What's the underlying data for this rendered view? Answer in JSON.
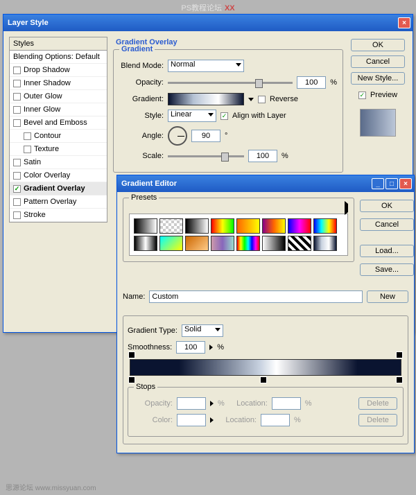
{
  "watermark": {
    "text1": "PS教程论坛",
    "text2": "XX"
  },
  "footer": "思源论坛  www.missyuan.com",
  "layerStyle": {
    "title": "Layer Style",
    "stylesHeader": "Styles",
    "blendingHeader": "Blending Options: Default",
    "items": [
      {
        "label": "Drop Shadow",
        "checked": false
      },
      {
        "label": "Inner Shadow",
        "checked": false
      },
      {
        "label": "Outer Glow",
        "checked": false
      },
      {
        "label": "Inner Glow",
        "checked": false
      },
      {
        "label": "Bevel and Emboss",
        "checked": false
      },
      {
        "label": "Contour",
        "checked": false,
        "sub": true
      },
      {
        "label": "Texture",
        "checked": false,
        "sub": true
      },
      {
        "label": "Satin",
        "checked": false
      },
      {
        "label": "Color Overlay",
        "checked": false
      },
      {
        "label": "Gradient Overlay",
        "checked": true,
        "bold": true
      },
      {
        "label": "Pattern Overlay",
        "checked": false
      },
      {
        "label": "Stroke",
        "checked": false
      }
    ],
    "sectionTitle": "Gradient Overlay",
    "gradientGroup": "Gradient",
    "blendMode": {
      "label": "Blend Mode:",
      "value": "Normal"
    },
    "opacity": {
      "label": "Opacity:",
      "value": "100",
      "suffix": "%"
    },
    "gradient": {
      "label": "Gradient:",
      "reverseLabel": "Reverse",
      "reverseChecked": false
    },
    "style": {
      "label": "Style:",
      "value": "Linear",
      "alignLabel": "Align with Layer",
      "alignChecked": true
    },
    "angle": {
      "label": "Angle:",
      "value": "90",
      "suffix": "°"
    },
    "scale": {
      "label": "Scale:",
      "value": "100",
      "suffix": "%"
    },
    "buttons": {
      "ok": "OK",
      "cancel": "Cancel",
      "newStyle": "New Style...",
      "previewLabel": "Preview",
      "previewChecked": true
    }
  },
  "gradEditor": {
    "title": "Gradient Editor",
    "presetsLabel": "Presets",
    "presets": [
      "linear-gradient(90deg,#000,#fff)",
      "repeating-conic-gradient(#ccc 0 25%,#fff 0 50%) 0/8px 8px",
      "linear-gradient(90deg,#000,#fff)",
      "linear-gradient(90deg,#f00,#ff0,#0f0)",
      "linear-gradient(90deg,#f60,#ff0)",
      "linear-gradient(90deg,#808,#f60,#ff0)",
      "linear-gradient(90deg,#00f,#f0f,#f00)",
      "linear-gradient(90deg,#00f,#0ff,#ff0,#f00)",
      "linear-gradient(90deg,#000,#fff,#000)",
      "linear-gradient(135deg,#0ff,#ff0)",
      "linear-gradient(135deg,#c60,#fc8)",
      "linear-gradient(90deg,#c9a,#86b,#9dc)",
      "linear-gradient(90deg,#f00,#ff0,#0f0,#0ff,#00f,#f0f,#f00)",
      "linear-gradient(90deg,#fff,#000)",
      "repeating-linear-gradient(45deg,#000 0 4px,#fff 4px 8px)",
      "linear-gradient(90deg,#0a1430,#c8d2e0,#fff,#0a1430)"
    ],
    "name": {
      "label": "Name:",
      "value": "Custom"
    },
    "newBtn": "New",
    "buttons": {
      "ok": "OK",
      "cancel": "Cancel",
      "load": "Load...",
      "save": "Save..."
    },
    "gtype": {
      "label": "Gradient Type:",
      "value": "Solid"
    },
    "smooth": {
      "label": "Smoothness:",
      "value": "100",
      "suffix": "%"
    },
    "stops": {
      "title": "Stops",
      "opacity": {
        "label": "Opacity:",
        "suffix": "%"
      },
      "location": {
        "label": "Location:",
        "suffix": "%"
      },
      "color": {
        "label": "Color:"
      },
      "delete": "Delete"
    }
  }
}
